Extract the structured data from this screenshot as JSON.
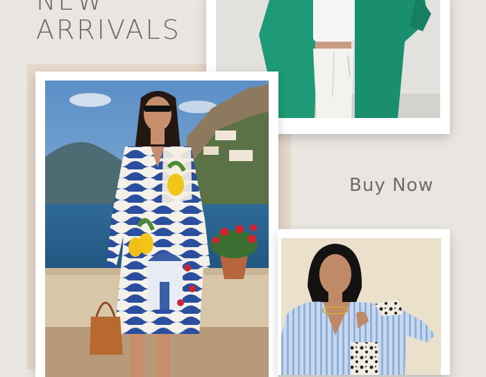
{
  "headline": {
    "line1": "NEW",
    "line2": "ARRIVALS"
  },
  "cta": {
    "label": "Buy Now"
  },
  "photos": {
    "top": {
      "description_icon": "green-shirt-outfit-image"
    },
    "main": {
      "description_icon": "lemon-print-dress-image"
    },
    "bottom": {
      "description_icon": "striped-leopard-shirt-image"
    }
  },
  "colors": {
    "background": "#e9e6e1",
    "accent_panel": "#e5d7ca",
    "text": "#6a6660",
    "frame": "#ffffff"
  }
}
